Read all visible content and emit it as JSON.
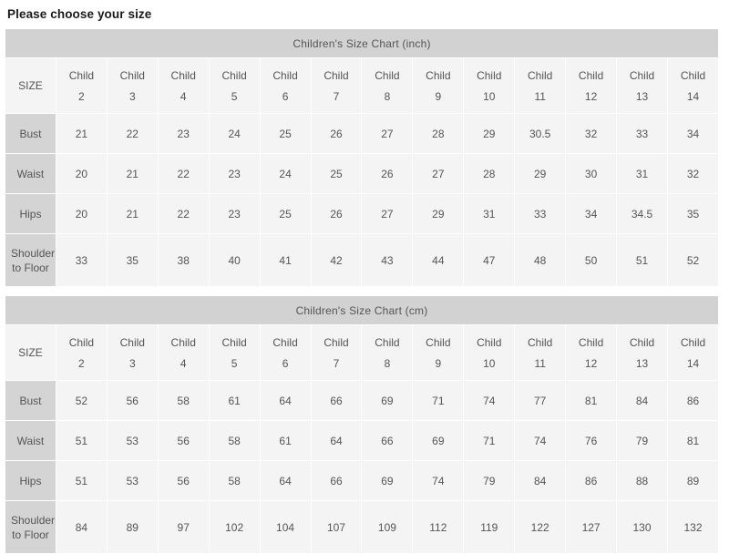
{
  "page": {
    "title": "Please choose your size"
  },
  "colors": {
    "caption_bg": "#d2d2d2",
    "label_bg": "#d4d4d4",
    "cell_bg": "#f4f4f4",
    "text": "#555555",
    "title_text": "#1a1a1a",
    "page_bg": "#ffffff"
  },
  "charts": [
    {
      "caption": "Children's Size Chart (inch)",
      "unit": "inch",
      "size_header_label": "SIZE",
      "columns": [
        {
          "word": "Child",
          "num": "2"
        },
        {
          "word": "Child",
          "num": "3"
        },
        {
          "word": "Child",
          "num": "4"
        },
        {
          "word": "Child",
          "num": "5"
        },
        {
          "word": "Child",
          "num": "6"
        },
        {
          "word": "Child",
          "num": "7"
        },
        {
          "word": "Child",
          "num": "8"
        },
        {
          "word": "Child",
          "num": "9"
        },
        {
          "word": "Child",
          "num": "10"
        },
        {
          "word": "Child",
          "num": "11"
        },
        {
          "word": "Child",
          "num": "12"
        },
        {
          "word": "Child",
          "num": "13"
        },
        {
          "word": "Child",
          "num": "14"
        }
      ],
      "rows": [
        {
          "label": "Bust",
          "values": [
            "21",
            "22",
            "23",
            "24",
            "25",
            "26",
            "27",
            "28",
            "29",
            "30.5",
            "32",
            "33",
            "34"
          ]
        },
        {
          "label": "Waist",
          "values": [
            "20",
            "21",
            "22",
            "23",
            "24",
            "25",
            "26",
            "27",
            "28",
            "29",
            "30",
            "31",
            "32"
          ]
        },
        {
          "label": "Hips",
          "values": [
            "20",
            "21",
            "22",
            "23",
            "25",
            "26",
            "27",
            "29",
            "31",
            "33",
            "34",
            "34.5",
            "35"
          ]
        },
        {
          "label": "Shoulder to Floor",
          "values": [
            "33",
            "35",
            "38",
            "40",
            "41",
            "42",
            "43",
            "44",
            "47",
            "48",
            "50",
            "51",
            "52"
          ]
        }
      ]
    },
    {
      "caption": "Children's Size Chart (cm)",
      "unit": "cm",
      "size_header_label": "SIZE",
      "columns": [
        {
          "word": "Child",
          "num": "2"
        },
        {
          "word": "Child",
          "num": "3"
        },
        {
          "word": "Child",
          "num": "4"
        },
        {
          "word": "Child",
          "num": "5"
        },
        {
          "word": "Child",
          "num": "6"
        },
        {
          "word": "Child",
          "num": "7"
        },
        {
          "word": "Child",
          "num": "8"
        },
        {
          "word": "Child",
          "num": "9"
        },
        {
          "word": "Child",
          "num": "10"
        },
        {
          "word": "Child",
          "num": "11"
        },
        {
          "word": "Child",
          "num": "12"
        },
        {
          "word": "Child",
          "num": "13"
        },
        {
          "word": "Child",
          "num": "14"
        }
      ],
      "rows": [
        {
          "label": "Bust",
          "values": [
            "52",
            "56",
            "58",
            "61",
            "64",
            "66",
            "69",
            "71",
            "74",
            "77",
            "81",
            "84",
            "86"
          ]
        },
        {
          "label": "Waist",
          "values": [
            "51",
            "53",
            "56",
            "58",
            "61",
            "64",
            "66",
            "69",
            "71",
            "74",
            "76",
            "79",
            "81"
          ]
        },
        {
          "label": "Hips",
          "values": [
            "51",
            "53",
            "56",
            "58",
            "64",
            "66",
            "69",
            "74",
            "79",
            "84",
            "86",
            "88",
            "89"
          ]
        },
        {
          "label": "Shoulder to Floor",
          "values": [
            "84",
            "89",
            "97",
            "102",
            "104",
            "107",
            "109",
            "112",
            "119",
            "122",
            "127",
            "130",
            "132"
          ]
        }
      ]
    }
  ]
}
